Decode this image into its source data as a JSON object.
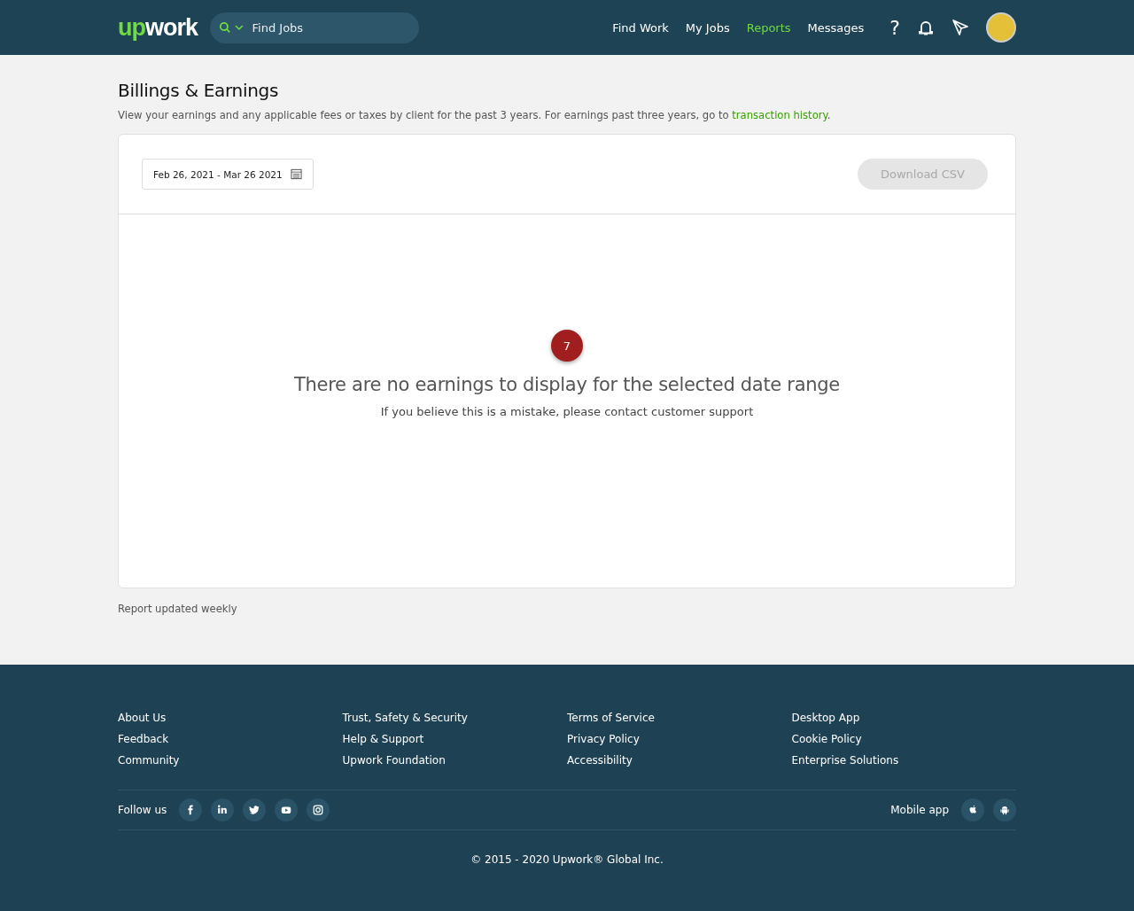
{
  "header": {
    "logo_parts": [
      "up",
      "work"
    ],
    "search": {
      "placeholder": "Find Jobs"
    },
    "nav": [
      {
        "label": "Find Work",
        "selected": false
      },
      {
        "label": "My Jobs",
        "selected": false
      },
      {
        "label": "Reports",
        "selected": true
      },
      {
        "label": "Messages",
        "selected": false
      }
    ],
    "help": "?"
  },
  "page": {
    "title": "Billings & Earnings",
    "subtitle": "View your earnings and any applicable fees or taxes by client for the past 3 years. For earnings past three years, go to ",
    "subtitle_link": "transaction history",
    "subtitle_end": ".",
    "date_range": "Feb 26, 2021 - Mar 26 2021",
    "download_button": {
      "label": "Download CSV",
      "disabled": true
    },
    "marker": "7",
    "empty_title": "There are no earnings to display for the selected date range",
    "empty_text": "If you believe this is a mistake, please contact customer support",
    "note": "Report updated weekly"
  },
  "footer": {
    "columns": [
      [
        "About Us",
        "Feedback",
        "Community"
      ],
      [
        "Trust, Safety & Security",
        "Help & Support",
        "Upwork Foundation"
      ],
      [
        "Terms of Service",
        "Privacy Policy",
        "Accessibility"
      ],
      [
        "Desktop App",
        "Cookie Policy",
        "Enterprise Solutions"
      ]
    ],
    "follow_label": "Follow us",
    "social": [
      {
        "kind": "facebook"
      },
      {
        "kind": "linkedin"
      },
      {
        "kind": "twitter"
      },
      {
        "kind": "youtube"
      },
      {
        "kind": "instagram"
      }
    ],
    "mobile_label": "Mobile app",
    "mobile": [
      {
        "kind": "apple"
      },
      {
        "kind": "android"
      }
    ],
    "copyright": "© 2015 - 2020 Upwork® Global Inc."
  }
}
